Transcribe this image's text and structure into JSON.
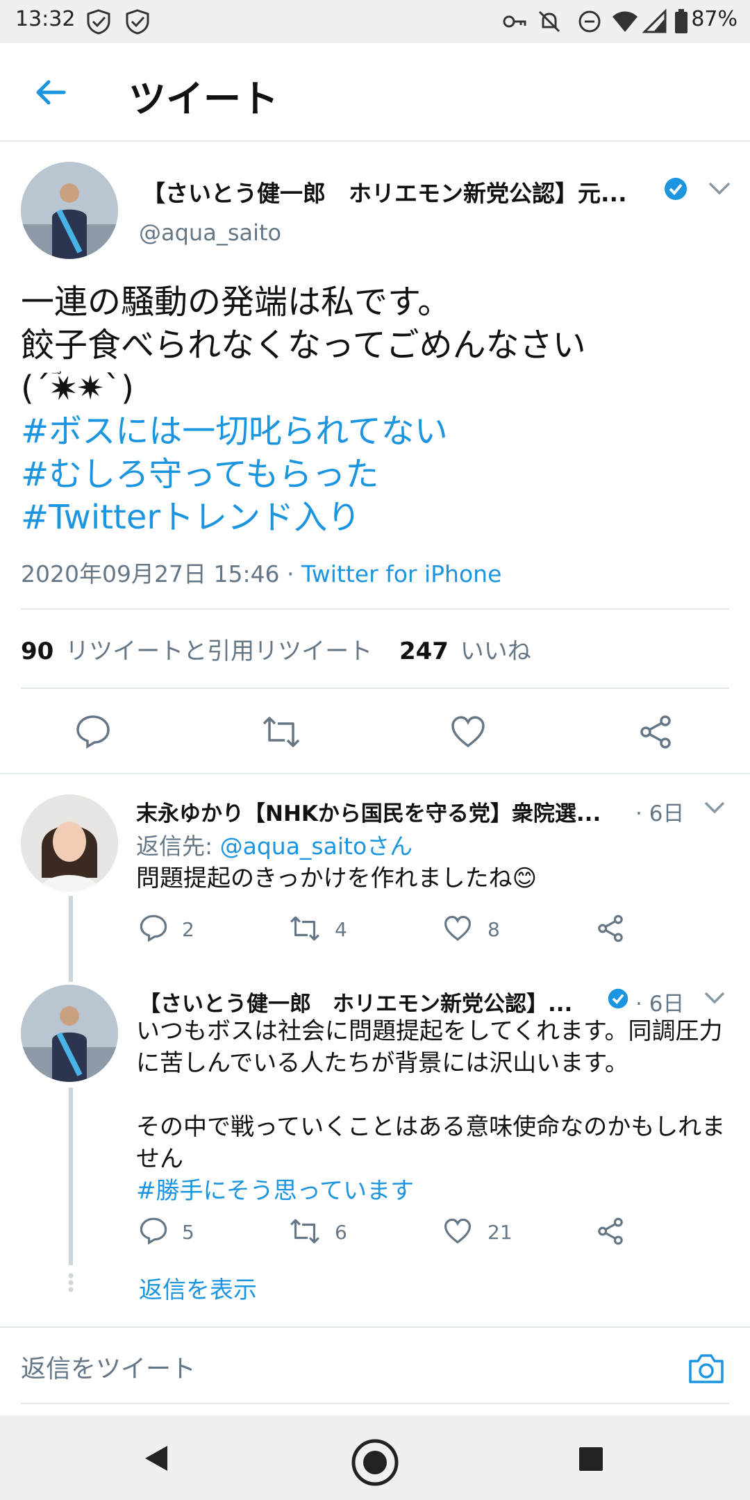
{
  "status_bar": {
    "time": "13:32",
    "battery": "87%"
  },
  "header": {
    "title": "ツイート"
  },
  "tweet": {
    "author_name": "【さいとう健一郎　ホリエモン新党公認】元...",
    "author_handle": "@aqua_saito",
    "text_lines": [
      "一連の騒動の発端は私です。",
      "餃子食べられなくなってごめんなさい",
      "(´✷ؔ✷`)"
    ],
    "hashtags": [
      "#ボスには一切叱られてない",
      "#むしろ守ってもらった",
      "#Twitterトレンド入り"
    ],
    "timestamp": "2020年09月27日 15:46 · ",
    "client": "Twitter for iPhone",
    "retweet_count": "90",
    "retweet_label": "リツイートと引用リツイート",
    "like_count": "247",
    "like_label": "いいね"
  },
  "replies": [
    {
      "name": "末永ゆかり【NHKから国民を守る党】衆院選...",
      "age": "· 6日",
      "reply_to_label": "返信先: ",
      "reply_to_handle": "@aqua_saitoさん",
      "text": "問題提起のきっかけを作れましたね😊",
      "reply_count": "2",
      "retweet_count": "4",
      "like_count": "8"
    },
    {
      "name": "【さいとう健一郎　ホリエモン新党公認】...",
      "age": "· 6日",
      "text_lines": [
        "いつもボスは社会に問題提起をしてくれます。同調圧力",
        "に苦しんでいる人たちが背景には沢山います。",
        "",
        "その中で戦っていくことはある意味使命なのかもしれま",
        "せん"
      ],
      "hashtag": "#勝手にそう思っています",
      "reply_count": "5",
      "retweet_count": "6",
      "like_count": "21"
    }
  ],
  "show_replies": "返信を表示",
  "compose": {
    "placeholder": "返信をツイート"
  },
  "colors": {
    "accent": "#1b95e0",
    "text": "#0f1419",
    "secondary": "#657786",
    "divider": "#e1e8ed"
  }
}
